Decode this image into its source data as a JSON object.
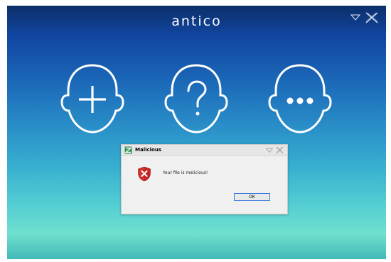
{
  "app": {
    "brand": "antico",
    "buttons": [
      {
        "name": "add-profile-button",
        "icon": "head-plus-icon"
      },
      {
        "name": "help-button",
        "icon": "head-question-icon"
      },
      {
        "name": "more-button",
        "icon": "head-ellipsis-icon"
      }
    ],
    "window_controls": {
      "minimize_icon": "triangle-down-icon",
      "close_icon": "close-icon"
    }
  },
  "dialog": {
    "title": "Malicious",
    "message": "Your file is malicious!",
    "ok_label": "OK",
    "icon": "shield-error-icon",
    "accent": "#3a7be0"
  },
  "colors": {
    "bg_top": "#0c2f6a",
    "bg_bottom": "#6fe0cf",
    "icon_line": "#ffffff",
    "error_red": "#d32f2f"
  }
}
